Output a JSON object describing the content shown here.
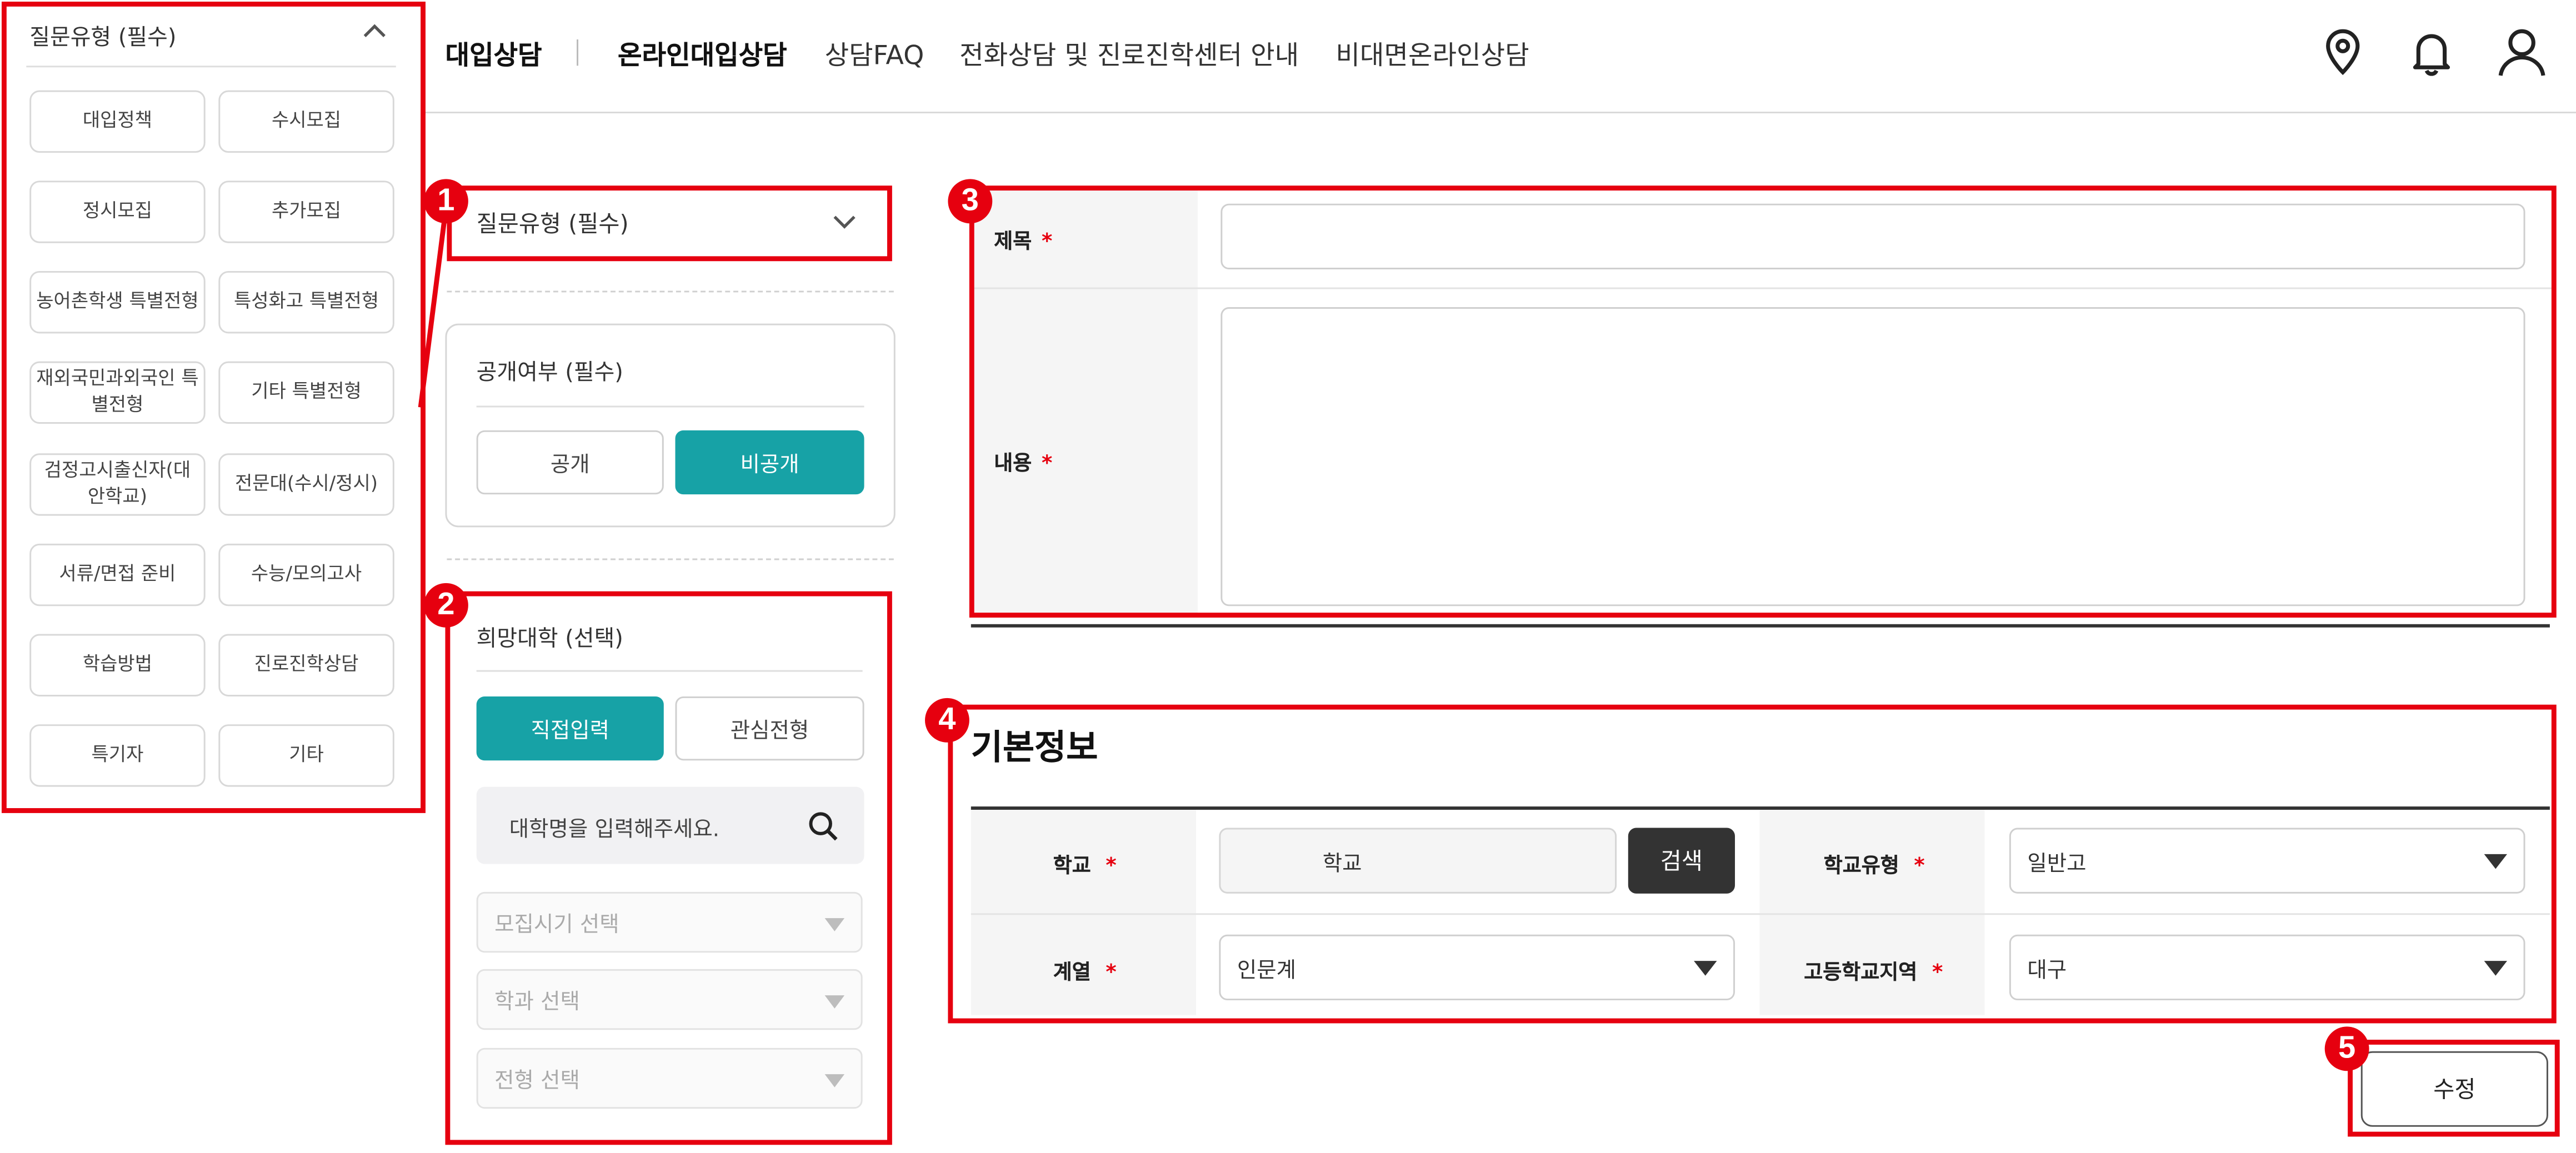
{
  "dropdown_panel": {
    "title": "질문유형 (필수)",
    "options": [
      "대입정책",
      "수시모집",
      "정시모집",
      "추가모집",
      "농어촌학생 특별전형",
      "특성화고 특별전형",
      "재외국민과외국인 특별전형",
      "기타 특별전형",
      "검정고시출신자(대안학교)",
      "전문대(수시/정시)",
      "서류/면접 준비",
      "수능/모의고사",
      "학습방법",
      "진로진학상담",
      "특기자",
      "기타"
    ]
  },
  "nav": {
    "items": [
      "대입상담",
      "온라인대입상담",
      "상담FAQ",
      "전화상담 및 진로진학센터 안내",
      "비대면온라인상담"
    ]
  },
  "question_type": {
    "label": "질문유형 (필수)"
  },
  "visibility": {
    "title": "공개여부 (필수)",
    "public_label": "공개",
    "private_label": "비공개"
  },
  "desired_university": {
    "title": "희망대학 (선택)",
    "tab_direct": "직접입력",
    "tab_interest": "관심전형",
    "search_placeholder": "대학명을 입력해주세요.",
    "select_period": "모집시기 선택",
    "select_department": "학과 선택",
    "select_admission": "전형 선택"
  },
  "form": {
    "title_label": "제목",
    "content_label": "내용",
    "required_mark": "*"
  },
  "basic_info": {
    "heading": "기본정보",
    "school_label": "학교",
    "school_value": "학교",
    "search_button": "검색",
    "school_type_label": "학교유형",
    "school_type_value": "일반고",
    "track_label": "계열",
    "track_value": "인문계",
    "region_label": "고등학교지역",
    "region_value": "대구"
  },
  "submit": {
    "label": "수정"
  },
  "annotations": {
    "b1": "1",
    "b2": "2",
    "b3": "3",
    "b4": "4",
    "b5": "5"
  },
  "colors": {
    "accent": "#17a2a6",
    "annotation": "#e6000f",
    "dark_button": "#333333"
  }
}
